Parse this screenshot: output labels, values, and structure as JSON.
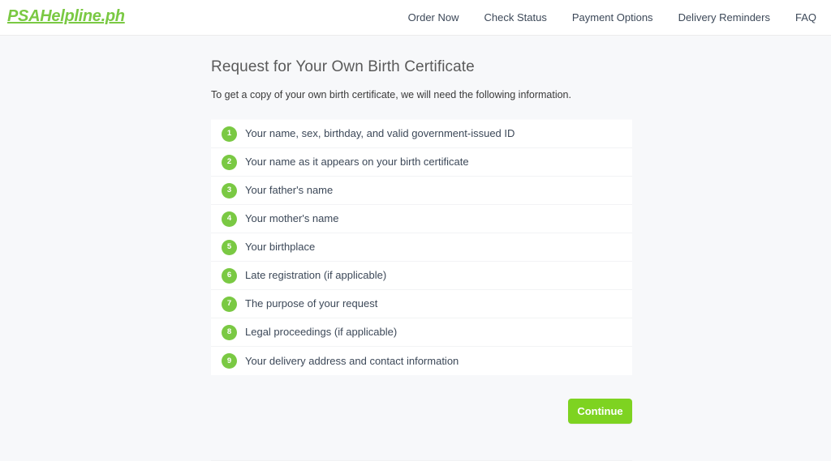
{
  "header": {
    "logo_text": "PSAHelpline.ph",
    "nav": [
      {
        "label": "Order Now"
      },
      {
        "label": "Check Status"
      },
      {
        "label": "Payment Options"
      },
      {
        "label": "Delivery Reminders"
      },
      {
        "label": "FAQ"
      }
    ]
  },
  "main": {
    "title": "Request for Your Own Birth Certificate",
    "subtitle": "To get a copy of your own birth certificate, we will need the following information.",
    "requirements": [
      {
        "number": "1",
        "label": "Your name, sex, birthday, and valid government-issued ID"
      },
      {
        "number": "2",
        "label": "Your name as it appears on your birth certificate"
      },
      {
        "number": "3",
        "label": "Your father's name"
      },
      {
        "number": "4",
        "label": "Your mother's name"
      },
      {
        "number": "5",
        "label": "Your birthplace"
      },
      {
        "number": "6",
        "label": "Late registration (if applicable)"
      },
      {
        "number": "7",
        "label": "The purpose of your request"
      },
      {
        "number": "8",
        "label": "Legal proceedings (if applicable)"
      },
      {
        "number": "9",
        "label": "Your delivery address and contact information"
      }
    ],
    "continue_label": "Continue"
  },
  "colors": {
    "brand_green": "#7ac943",
    "button_green": "#7ed321",
    "page_background": "#f7f8fa",
    "text_dark": "#3c4858"
  }
}
